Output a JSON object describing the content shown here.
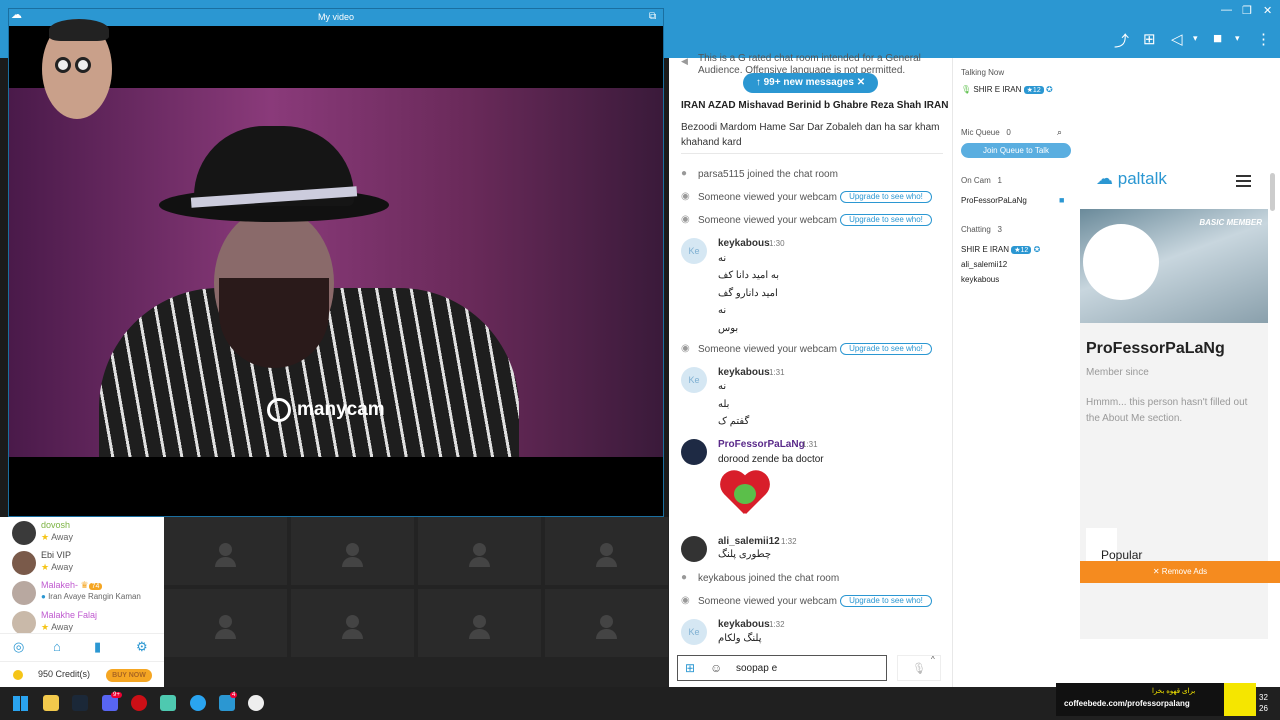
{
  "video": {
    "title": "My video",
    "overlay_logo": "manycam"
  },
  "chat": {
    "partial_notice": "This is a G rated chat room intended for a General Audience. Offensive language is not permitted.",
    "new_messages": "99+ new messages",
    "topic_title": "IRAN AZAD Mishavad Berinid b Ghabre Reza Shah IRAN",
    "topic_body": "Bezoodi Mardom Hame Sar Dar Zobaleh dan ha sar kham khahand kard",
    "joined_1": "parsa5115 joined the chat room",
    "webcam_view": "Someone viewed your webcam",
    "upgrade": "Upgrade to see who!",
    "messages": [
      {
        "author": "keykabous",
        "time": "1:30",
        "initials": "Ke",
        "lines": [
          "نه",
          "به امید دانا کف",
          "امید دانارو گف",
          "نه",
          "بوس"
        ]
      },
      {
        "author": "keykabous",
        "time": "1:31",
        "initials": "Ke",
        "lines": [
          "نه",
          "بله",
          "گفتم ک"
        ]
      },
      {
        "author": "ProFessorPaLaNg",
        "time": "1:31",
        "initials": "",
        "lines": [
          "dorood zende ba doctor"
        ]
      },
      {
        "author": "ali_salemii12",
        "time": "1:32",
        "initials": "",
        "lines": [
          "چطوری پلنگ"
        ]
      },
      {
        "author": "keykabous",
        "time": "1:32",
        "initials": "Ke",
        "lines": [
          "پلنگ ولکام"
        ]
      }
    ],
    "joined_2": "keykabous joined the chat room",
    "input_value": "soopap e"
  },
  "room": {
    "talking_now_label": "Talking Now",
    "talking_now_user": "SHIR E IRAN",
    "badge": "12",
    "mic_queue_label": "Mic Queue",
    "mic_queue_count": "0",
    "join_queue": "Join Queue to Talk",
    "on_cam_label": "On Cam",
    "on_cam_count": "1",
    "on_cam_user": "ProFessorPaLaNg",
    "chatting_label": "Chatting",
    "chatting_count": "3",
    "chatting_users": [
      "SHIR E IRAN",
      "ali_salemii12",
      "keykabous"
    ]
  },
  "profile": {
    "brand": "paltalk",
    "member_tag": "BASIC MEMBER",
    "name": "ProFessorPaLaNg",
    "member_since": "Member since",
    "about": "Hmmm... this person hasn't filled out the About Me section.",
    "popular": "Popular",
    "remove_ads": "✕ Remove Ads"
  },
  "sidebar": {
    "users": [
      {
        "name": "dovosh",
        "status": "Away",
        "color": "#7cb342"
      },
      {
        "name": "Ebi VIP",
        "status": "Away",
        "color": "#444444"
      },
      {
        "name": "Malakeh-",
        "status": "Iran Avaye Rangin Kaman",
        "color": "#c05ad0",
        "badge": "74"
      },
      {
        "name": "Malakhe Falaj",
        "status": "Away",
        "color": "#c05ad0"
      }
    ],
    "credits": "950 Credit(s)",
    "buy_now": "BUY NOW"
  },
  "taskbar": {
    "ad_top": "برای قهوه بخرا",
    "ad_url": "coffeebede.com/professorpalang",
    "clock_top": "32",
    "clock_bottom": "26",
    "discord_badge": "9+",
    "paltalk_badge": "4"
  },
  "colors": {
    "accent": "#2b97d2",
    "remove_ads": "#f58b1f",
    "buy_now": "#f5a623"
  }
}
